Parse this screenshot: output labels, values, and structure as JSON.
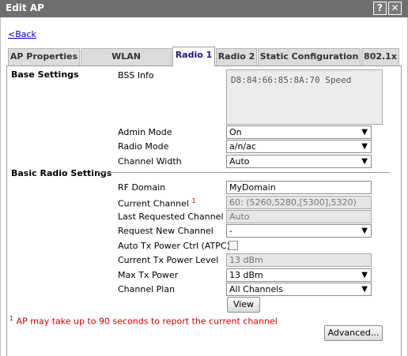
{
  "window": {
    "title": "Edit AP",
    "help_label": "?",
    "close_label": "✕"
  },
  "back_link": "<Back",
  "tabs": [
    {
      "label": "AP Properties"
    },
    {
      "label": "WLAN Assignment"
    },
    {
      "label": "Radio 1"
    },
    {
      "label": "Radio 2"
    },
    {
      "label": "Static Configuration"
    },
    {
      "label": "802.1x"
    }
  ],
  "active_tab": "Radio 1",
  "base_settings": {
    "heading": "Base Settings",
    "bss_info_label": "BSS Info",
    "bss_info_value": "D8:84:66:85:8A:70  Speed",
    "admin_mode_label": "Admin Mode",
    "admin_mode_value": "On",
    "radio_mode_label": "Radio Mode",
    "radio_mode_value": "a/n/ac",
    "channel_width_label": "Channel Width",
    "channel_width_value": "Auto"
  },
  "basic_radio": {
    "heading": "Basic Radio Settings",
    "rf_domain_label": "RF Domain",
    "rf_domain_value": "MyDomain",
    "current_channel_label": "Current Channel",
    "current_channel_note": "1",
    "current_channel_value": "60: (5260,5280,[5300],5320)",
    "last_requested_label": "Last Requested Channel",
    "last_requested_value": "Auto",
    "request_new_label": "Request New Channel",
    "request_new_value": "-",
    "atpc_label": "Auto Tx Power Ctrl (ATPC)",
    "atpc_checked": false,
    "current_tx_label": "Current Tx Power Level",
    "current_tx_value": "13 dBm",
    "max_tx_label": "Max Tx Power",
    "max_tx_value": "13 dBm",
    "channel_plan_label": "Channel Plan",
    "channel_plan_value": "All Channels",
    "view_button": "View"
  },
  "footnote": {
    "marker": "1",
    "text": " AP may take up to 90 seconds to report the current channel"
  },
  "advanced_button": "Advanced...",
  "icons": {
    "dropdown": "chevron-down-icon"
  }
}
